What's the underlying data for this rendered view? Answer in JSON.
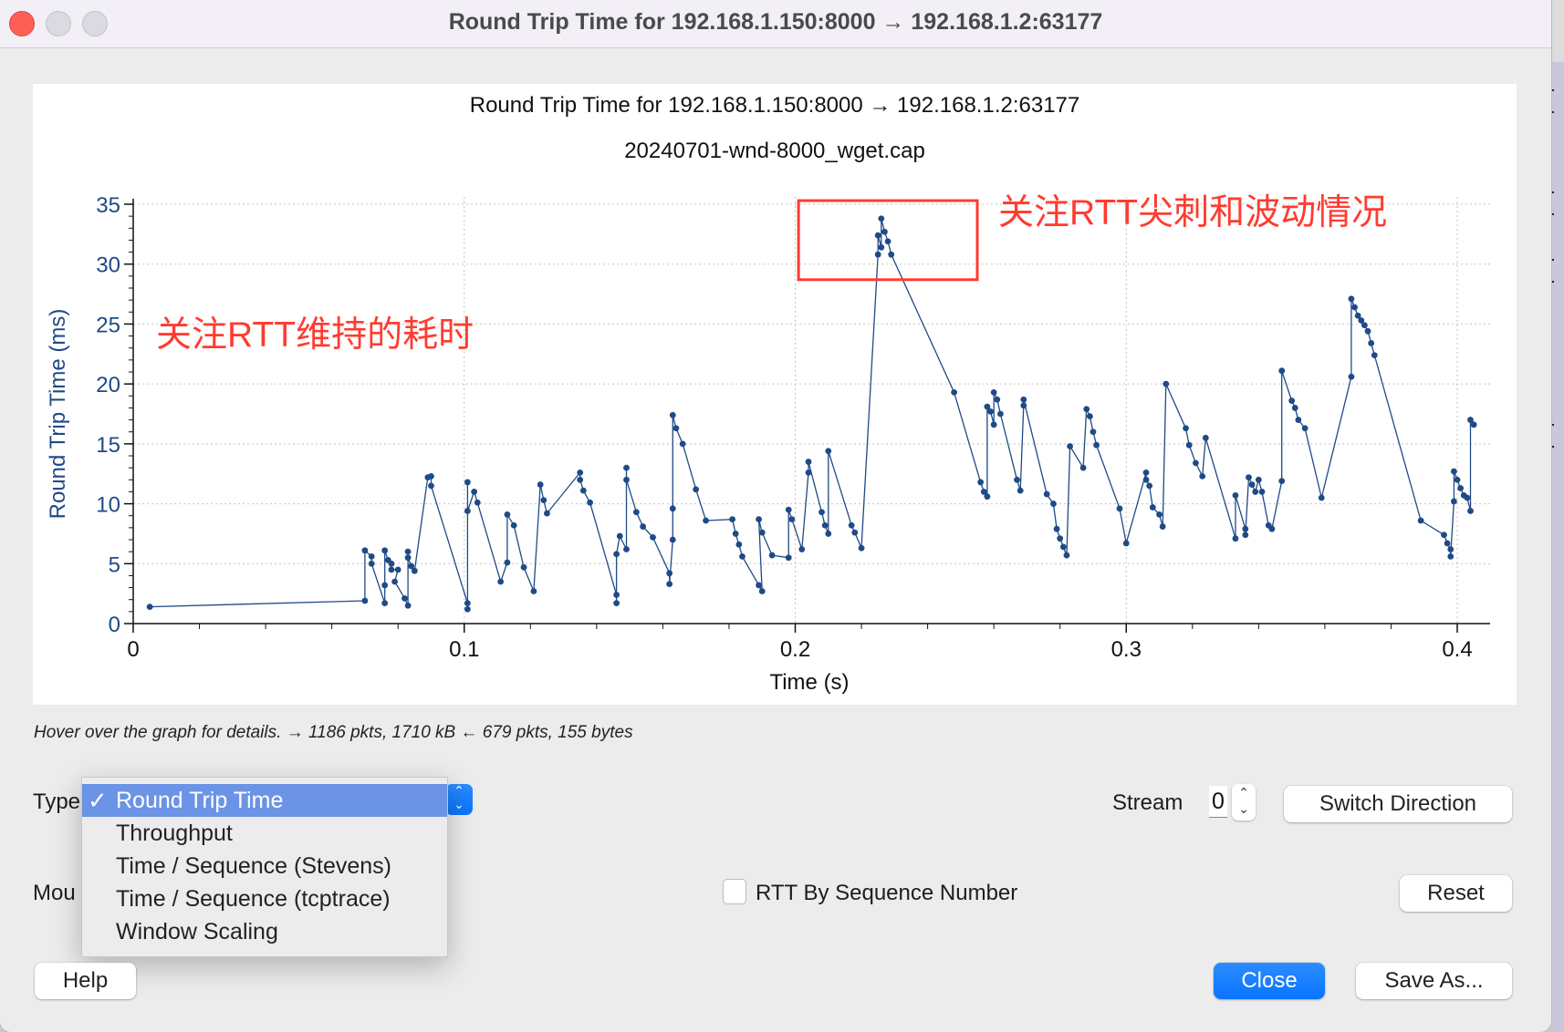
{
  "window": {
    "title": "Round Trip Time for 192.168.1.150:8000 → 192.168.1.2:63177"
  },
  "chart_data": {
    "type": "line",
    "title": "Round Trip Time for 192.168.1.150:8000 → 192.168.1.2:63177",
    "subtitle": "20240701-wnd-8000_wget.cap",
    "xlabel": "Time (s)",
    "ylabel": "Round Trip Time (ms)",
    "xlim": [
      0,
      0.41
    ],
    "ylim": [
      0,
      35
    ],
    "xticks": [
      "0",
      "0.1",
      "0.2",
      "0.3",
      "0.4"
    ],
    "xtick_values": [
      0,
      0.1,
      0.2,
      0.3,
      0.4
    ],
    "yticks": [
      "0",
      "5",
      "10",
      "15",
      "20",
      "25",
      "30",
      "35"
    ],
    "ytick_values": [
      0,
      5,
      10,
      15,
      20,
      25,
      30,
      35
    ],
    "grid": true,
    "series_color": "#1f4a87",
    "series": [
      {
        "name": "RTT",
        "x": [
          0.005,
          0.07,
          0.07,
          0.072,
          0.072,
          0.076,
          0.076,
          0.076,
          0.077,
          0.078,
          0.078,
          0.08,
          0.079,
          0.082,
          0.083,
          0.083,
          0.083,
          0.084,
          0.085,
          0.089,
          0.09,
          0.09,
          0.101,
          0.101,
          0.101,
          0.101,
          0.103,
          0.104,
          0.111,
          0.113,
          0.113,
          0.115,
          0.118,
          0.121,
          0.123,
          0.124,
          0.125,
          0.135,
          0.135,
          0.136,
          0.138,
          0.146,
          0.146,
          0.146,
          0.147,
          0.149,
          0.149,
          0.149,
          0.152,
          0.154,
          0.157,
          0.162,
          0.162,
          0.163,
          0.163,
          0.163,
          0.164,
          0.166,
          0.17,
          0.173,
          0.181,
          0.182,
          0.183,
          0.184,
          0.189,
          0.19,
          0.189,
          0.19,
          0.193,
          0.198,
          0.198,
          0.199,
          0.202,
          0.204,
          0.204,
          0.208,
          0.209,
          0.21,
          0.21,
          0.217,
          0.218,
          0.22,
          0.225,
          0.225,
          0.226,
          0.226,
          0.227,
          0.228,
          0.229,
          0.248,
          0.256,
          0.257,
          0.258,
          0.258,
          0.259,
          0.26,
          0.26,
          0.261,
          0.262,
          0.267,
          0.268,
          0.269,
          0.269,
          0.276,
          0.278,
          0.279,
          0.28,
          0.281,
          0.282,
          0.283,
          0.287,
          0.288,
          0.289,
          0.29,
          0.291,
          0.298,
          0.3,
          0.306,
          0.306,
          0.307,
          0.308,
          0.31,
          0.311,
          0.312,
          0.318,
          0.319,
          0.321,
          0.323,
          0.324,
          0.333,
          0.333,
          0.336,
          0.336,
          0.337,
          0.338,
          0.339,
          0.34,
          0.341,
          0.343,
          0.344,
          0.347,
          0.347,
          0.35,
          0.351,
          0.352,
          0.354,
          0.359,
          0.368,
          0.368,
          0.369,
          0.37,
          0.371,
          0.372,
          0.373,
          0.374,
          0.375,
          0.389,
          0.396,
          0.397,
          0.398,
          0.398,
          0.399,
          0.399,
          0.4,
          0.401,
          0.402,
          0.403,
          0.404,
          0.404,
          0.405
        ],
        "y": [
          1.4,
          1.9,
          6.1,
          5.6,
          5.0,
          1.7,
          3.2,
          6.1,
          5.3,
          5.0,
          4.5,
          4.5,
          3.5,
          2.1,
          1.5,
          6.0,
          5.5,
          4.8,
          4.4,
          12.2,
          12.3,
          11.5,
          1.7,
          1.2,
          11.8,
          9.4,
          11.0,
          10.1,
          3.5,
          5.1,
          9.1,
          8.2,
          4.7,
          2.7,
          11.6,
          10.3,
          9.2,
          12.6,
          12.0,
          11.1,
          10.1,
          2.4,
          1.7,
          5.8,
          7.3,
          6.2,
          13.0,
          12.0,
          9.3,
          8.1,
          7.2,
          4.2,
          3.3,
          7.0,
          9.6,
          17.4,
          16.3,
          15.0,
          11.2,
          8.6,
          8.7,
          7.5,
          6.6,
          5.6,
          3.2,
          2.7,
          8.7,
          7.6,
          5.7,
          5.5,
          9.5,
          8.7,
          6.2,
          12.6,
          13.5,
          9.3,
          8.2,
          7.5,
          14.4,
          8.2,
          7.6,
          6.3,
          30.8,
          32.4,
          31.4,
          33.8,
          32.7,
          31.9,
          30.8,
          19.3,
          11.8,
          11.0,
          10.6,
          18.1,
          17.7,
          16.6,
          19.3,
          18.7,
          17.5,
          12.0,
          11.1,
          18.2,
          18.7,
          10.8,
          10.0,
          7.9,
          7.1,
          6.4,
          5.7,
          14.8,
          13.0,
          17.9,
          17.3,
          16.0,
          14.9,
          9.6,
          6.7,
          12.6,
          12.0,
          11.5,
          9.7,
          9.1,
          8.1,
          20.0,
          16.3,
          14.9,
          13.4,
          12.3,
          15.5,
          7.1,
          10.7,
          7.9,
          7.4,
          12.2,
          11.6,
          11.0,
          12.0,
          11.0,
          8.2,
          7.9,
          11.9,
          21.1,
          18.6,
          18.0,
          17.0,
          16.3,
          10.5,
          20.6,
          27.1,
          26.4,
          25.7,
          25.3,
          24.9,
          24.4,
          23.4,
          22.4,
          8.6,
          7.4,
          6.7,
          6.2,
          5.6,
          10.2,
          12.7,
          12.0,
          11.3,
          10.7,
          10.5,
          9.4,
          17.0,
          16.6
        ]
      }
    ],
    "annotations": [
      {
        "text": "关注RTT维持的耗时",
        "color": "#ff3b30"
      },
      {
        "text": "关注RTT尖刺和波动情况",
        "color": "#ff3b30",
        "highlight_box": {
          "x_range": [
            0.201,
            0.255
          ],
          "y_range": [
            28.7,
            35.3
          ]
        }
      }
    ]
  },
  "status": {
    "text": "Hover over the graph for details. → 1186 pkts, 1710 kB ← 679 pkts, 155 bytes"
  },
  "controls": {
    "type_label": "Type",
    "mouse_label": "Mou",
    "type_menu": {
      "selected": "Round Trip Time",
      "check": "✓",
      "options": [
        "Round Trip Time",
        "Throughput",
        "Time / Sequence (Stevens)",
        "Time / Sequence (tcptrace)",
        "Window Scaling"
      ]
    },
    "stream_label": "Stream",
    "stream_value": "0",
    "switch_direction": "Switch Direction",
    "rtt_by_seq_label": "RTT By Sequence Number",
    "rtt_by_seq_checked": false,
    "reset": "Reset",
    "help": "Help",
    "close": "Close",
    "save_as": "Save As..."
  }
}
